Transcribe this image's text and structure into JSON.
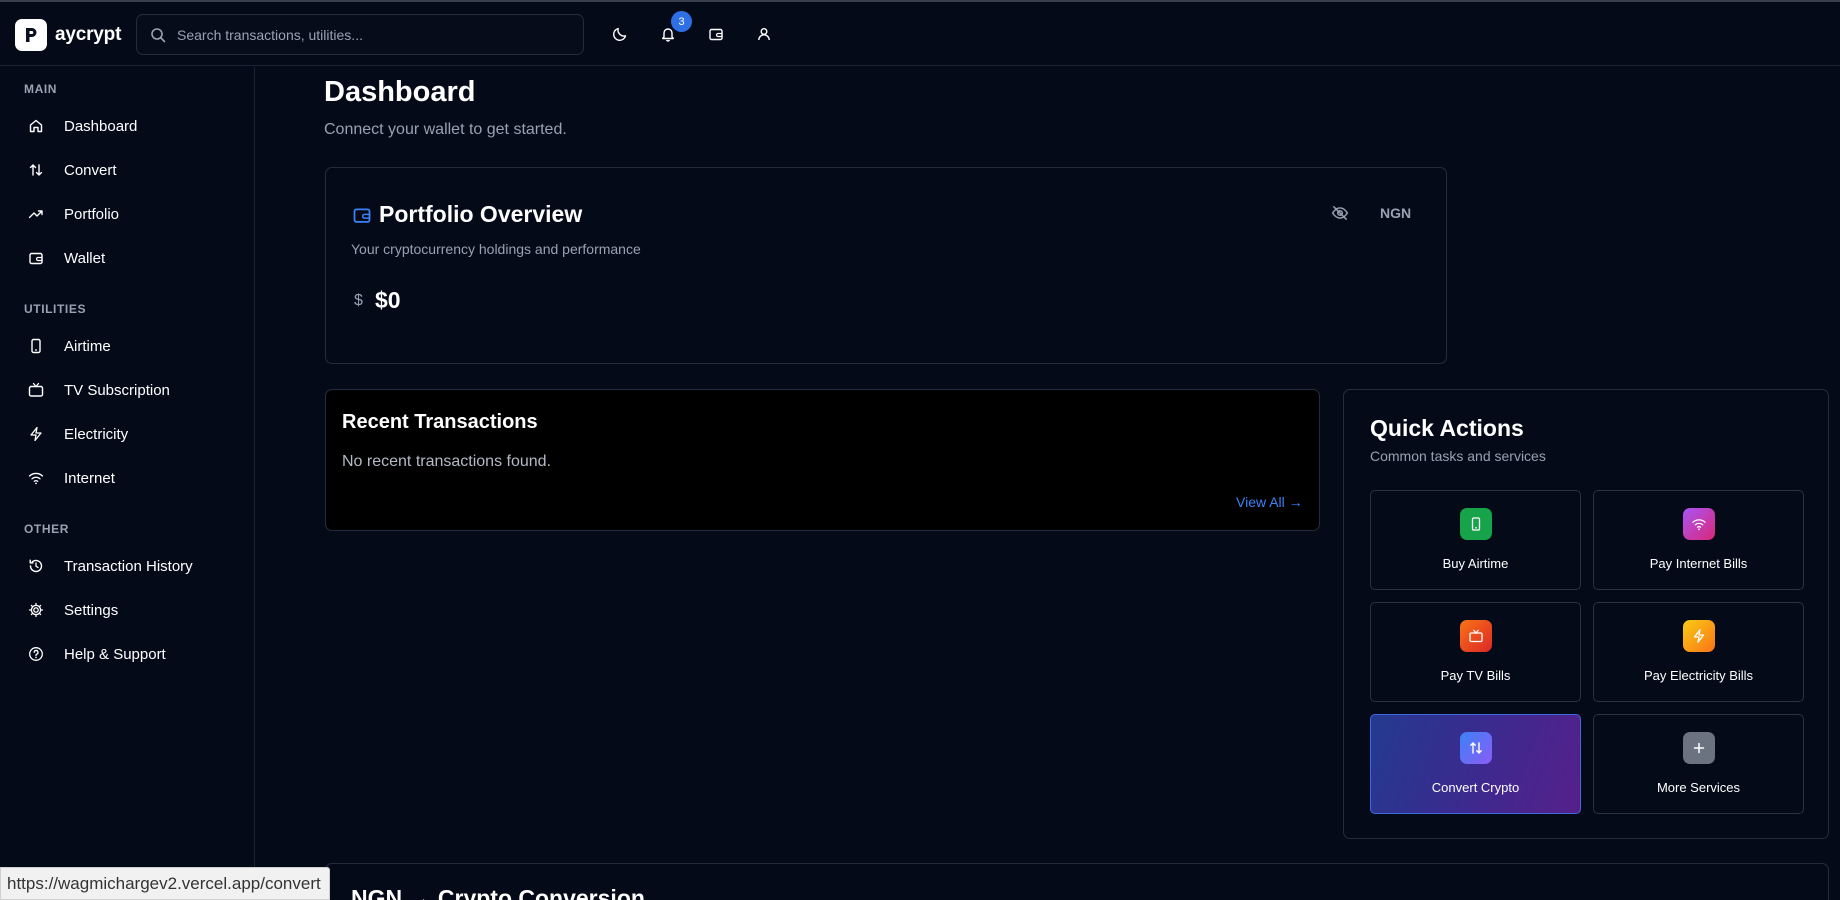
{
  "header": {
    "app_name": "aycrypt",
    "search_placeholder": "Search transactions, utilities...",
    "notification_count": "3"
  },
  "sidebar": {
    "sections": [
      {
        "title": "MAIN",
        "items": [
          "Dashboard",
          "Convert",
          "Portfolio",
          "Wallet"
        ]
      },
      {
        "title": "UTILITIES",
        "items": [
          "Airtime",
          "TV Subscription",
          "Electricity",
          "Internet"
        ]
      },
      {
        "title": "OTHER",
        "items": [
          "Transaction History",
          "Settings",
          "Help & Support"
        ]
      }
    ]
  },
  "page": {
    "title": "Dashboard",
    "subtitle": "Connect your wallet to get started."
  },
  "portfolio": {
    "title": "Portfolio Overview",
    "subtitle": "Your cryptocurrency holdings and performance",
    "currency": "NGN",
    "balance": "$0"
  },
  "recent": {
    "title": "Recent Transactions",
    "empty_text": "No recent transactions found.",
    "view_all": "View All →"
  },
  "quick_actions": {
    "title": "Quick Actions",
    "subtitle": "Common tasks and services",
    "items": [
      {
        "label": "Buy Airtime",
        "icon": "phone-icon",
        "color": "#16a34a"
      },
      {
        "label": "Pay Internet Bills",
        "icon": "wifi-icon",
        "color": "#c026d3"
      },
      {
        "label": "Pay TV Bills",
        "icon": "tv-icon",
        "color": "#ea580c"
      },
      {
        "label": "Pay Electricity Bills",
        "icon": "zap-icon",
        "color": "#f59e0b"
      },
      {
        "label": "Convert Crypto",
        "icon": "arrows-icon",
        "color": "#6d28d9"
      },
      {
        "label": "More Services",
        "icon": "plus-icon",
        "color": "#6b7280"
      }
    ]
  },
  "conversion": {
    "title": "NGN → Crypto Conversion"
  },
  "status_bar": {
    "url": "https://wagmichargev2.vercel.app/convert"
  }
}
